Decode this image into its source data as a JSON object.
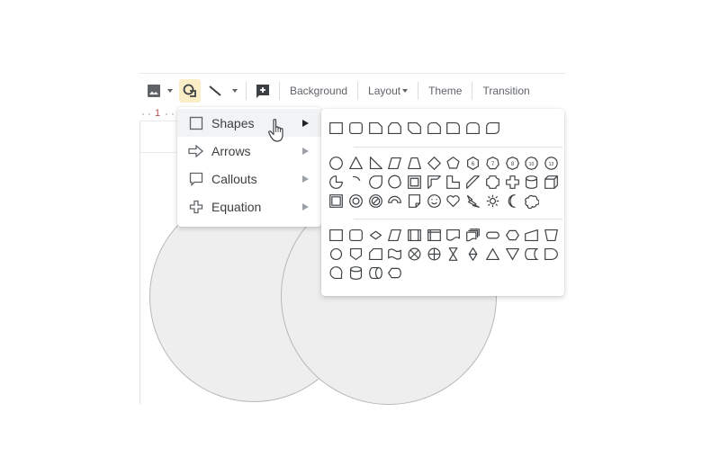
{
  "toolbar": {
    "items": [
      {
        "name": "image",
        "icon": "image-icon",
        "has_dropdown": true
      },
      {
        "name": "shape",
        "icon": "shape-icon",
        "active": true
      },
      {
        "name": "line",
        "icon": "line-icon",
        "has_dropdown": true
      },
      {
        "name": "new-slide-comment",
        "icon": "add-comment-icon"
      }
    ],
    "background_label": "Background",
    "layout_label": "Layout",
    "theme_label": "Theme",
    "transition_label": "Transition"
  },
  "ruler": {
    "number": "1"
  },
  "shape_menu": {
    "items": [
      {
        "label": "Shapes",
        "icon": "square-icon",
        "highlighted": true
      },
      {
        "label": "Arrows",
        "icon": "arrow-right-icon"
      },
      {
        "label": "Callouts",
        "icon": "callout-icon"
      },
      {
        "label": "Equation",
        "icon": "plus-icon"
      }
    ]
  },
  "shapes_submenu": {
    "groups": [
      {
        "name": "rectangles",
        "shapes": [
          "rectangle",
          "rounded-rectangle",
          "snip-single-corner",
          "snip-same-side",
          "snip-diagonal",
          "snip-round-single",
          "round-single-corner",
          "round-same-side",
          "round-diagonal"
        ]
      },
      {
        "name": "basic",
        "shapes": [
          "oval",
          "triangle",
          "right-triangle",
          "parallelogram",
          "trapezoid",
          "diamond",
          "pentagon",
          "hexagon-6",
          "heptagon-7",
          "octagon-8",
          "decagon-10",
          "dodecagon-12",
          "pie",
          "arc",
          "teardrop",
          "chord",
          "frame",
          "half-frame",
          "l-shape",
          "diagonal-stripe",
          "plaque",
          "cross",
          "can",
          "cube",
          "bevel",
          "donut",
          "no-symbol",
          "block-arc",
          "folded-corner",
          "smiley",
          "heart",
          "lightning",
          "sun",
          "moon",
          "cloud"
        ]
      },
      {
        "name": "flowchart",
        "shapes": [
          "process",
          "alternate-process",
          "decision",
          "data",
          "predefined-process",
          "internal-storage",
          "document",
          "multi-document",
          "terminator",
          "preparation",
          "manual-input",
          "manual-operation",
          "connector",
          "off-page-connector",
          "card",
          "punched-tape",
          "summing-junction",
          "or",
          "collate",
          "sort",
          "extract",
          "merge",
          "stored-data",
          "delay",
          "sequential-access-storage",
          "magnetic-disk",
          "direct-access-storage",
          "display"
        ]
      }
    ],
    "labels": {
      "6": "6",
      "7": "7",
      "8": "8",
      "10": "10",
      "12": "12"
    }
  },
  "canvas": {
    "shapes": [
      "circle-left",
      "circle-right"
    ]
  }
}
